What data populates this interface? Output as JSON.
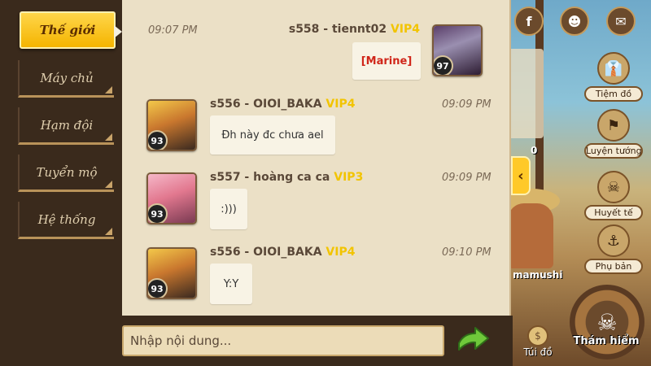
{
  "sidebar": {
    "tabs": [
      {
        "label": "Thế giới",
        "active": true
      },
      {
        "label": "Máy chủ",
        "active": false
      },
      {
        "label": "Hạm đội",
        "active": false
      },
      {
        "label": "Tuyển mộ",
        "active": false
      },
      {
        "label": "Hệ thống",
        "active": false
      }
    ]
  },
  "messages": [
    {
      "time": "09:07 PM",
      "sender": "s558 - tiennt02",
      "vip": "VIP4",
      "text": "[Marine]",
      "level": "97",
      "side": "right"
    },
    {
      "time": "09:09 PM",
      "sender": "s556 - OIOI_BAKA",
      "vip": "VIP4",
      "text": "Đh này đc chưa ael",
      "level": "93",
      "side": "left"
    },
    {
      "time": "09:09 PM",
      "sender": "s557 - hoàng ca ca",
      "vip": "VIP3",
      "text": ":)))",
      "level": "93",
      "side": "left"
    },
    {
      "time": "09:10 PM",
      "sender": "s556 - OIOI_BAKA",
      "vip": "VIP4",
      "text": "Y:Y",
      "level": "93",
      "side": "left"
    }
  ],
  "input": {
    "placeholder": "Nhập nội dung..."
  },
  "game_menu": {
    "shop": "Tiệm đồ",
    "training": "Luyện tướng",
    "blood": "Huyết tế",
    "instance": "Phụ bản",
    "map": "Túi đồ",
    "explore": "Thám hiểm",
    "partial_label": "mamushi",
    "partial_number": "0"
  },
  "colors": {
    "vip": "#f2c400",
    "active_tab": "#f4b400",
    "panel": "#ebe0c6"
  }
}
